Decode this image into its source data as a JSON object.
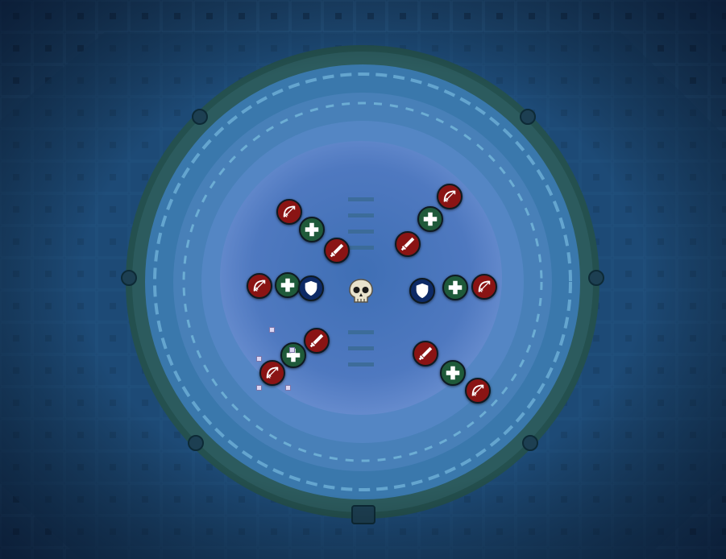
{
  "arena": {
    "floor_color": "#1f4c78",
    "ring_color": "#3f7fb5",
    "pool_color": "#5c86c8",
    "rim_color": "#2e5a5a"
  },
  "boss": {
    "icon": "skull-icon"
  },
  "roles": {
    "dps": {
      "color": "#8a1414"
    },
    "healer": {
      "color": "#1f5a3a"
    },
    "tank": {
      "color": "#0d2a66"
    }
  },
  "markers": [
    {
      "role": "dps",
      "icon": "bow-icon"
    },
    {
      "role": "healer",
      "icon": "plus-icon"
    },
    {
      "role": "dps",
      "icon": "sword-icon"
    },
    {
      "role": "dps",
      "icon": "bow-icon"
    },
    {
      "role": "healer",
      "icon": "plus-icon"
    },
    {
      "role": "dps",
      "icon": "sword-icon"
    },
    {
      "role": "dps",
      "icon": "bow-icon"
    },
    {
      "role": "healer",
      "icon": "plus-icon"
    },
    {
      "role": "tank",
      "icon": "shield-icon"
    },
    {
      "role": "tank",
      "icon": "shield-icon"
    },
    {
      "role": "healer",
      "icon": "plus-icon"
    },
    {
      "role": "dps",
      "icon": "bow-icon"
    },
    {
      "role": "dps",
      "icon": "sword-icon"
    },
    {
      "role": "healer",
      "icon": "plus-icon"
    },
    {
      "role": "dps",
      "icon": "bow-icon"
    },
    {
      "role": "dps",
      "icon": "sword-icon"
    },
    {
      "role": "healer",
      "icon": "plus-icon"
    },
    {
      "role": "dps",
      "icon": "bow-icon"
    }
  ]
}
